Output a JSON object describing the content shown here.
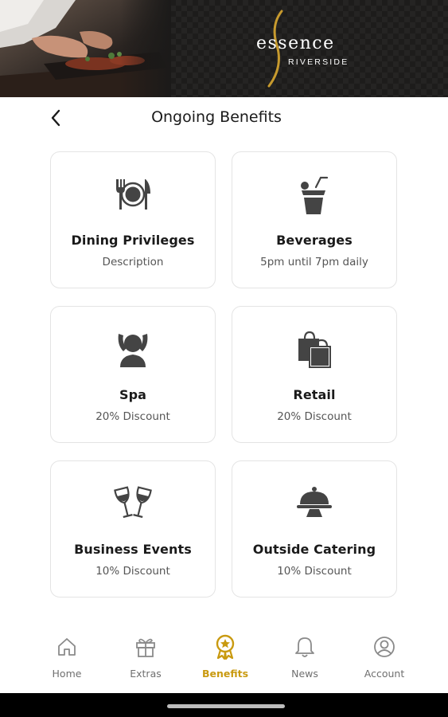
{
  "banner": {
    "logo_word": "essence",
    "logo_sub": "RIVERSIDE"
  },
  "header": {
    "title": "Ongoing Benefits"
  },
  "benefits": [
    {
      "name": "Dining Privileges",
      "desc": "Description",
      "icon": "dining-icon"
    },
    {
      "name": "Beverages",
      "desc": "5pm until 7pm daily",
      "icon": "cocktail-icon"
    },
    {
      "name": "Spa",
      "desc": "20% Discount",
      "icon": "spa-icon"
    },
    {
      "name": "Retail",
      "desc": "20% Discount",
      "icon": "shopping-bag-icon"
    },
    {
      "name": "Business Events",
      "desc": "10% Discount",
      "icon": "wine-glasses-icon"
    },
    {
      "name": "Outside Catering",
      "desc": "10% Discount",
      "icon": "cloche-icon"
    }
  ],
  "nav": {
    "items": [
      {
        "label": "Home",
        "icon": "home-icon"
      },
      {
        "label": "Extras",
        "icon": "gift-icon"
      },
      {
        "label": "Benefits",
        "icon": "award-icon",
        "active": true
      },
      {
        "label": "News",
        "icon": "bell-icon"
      },
      {
        "label": "Account",
        "icon": "account-icon"
      }
    ]
  },
  "colors": {
    "accent": "#c99a10",
    "icon_gray": "#444444",
    "card_border": "#e4e4e4",
    "banner_bg": "#1b1a19"
  }
}
